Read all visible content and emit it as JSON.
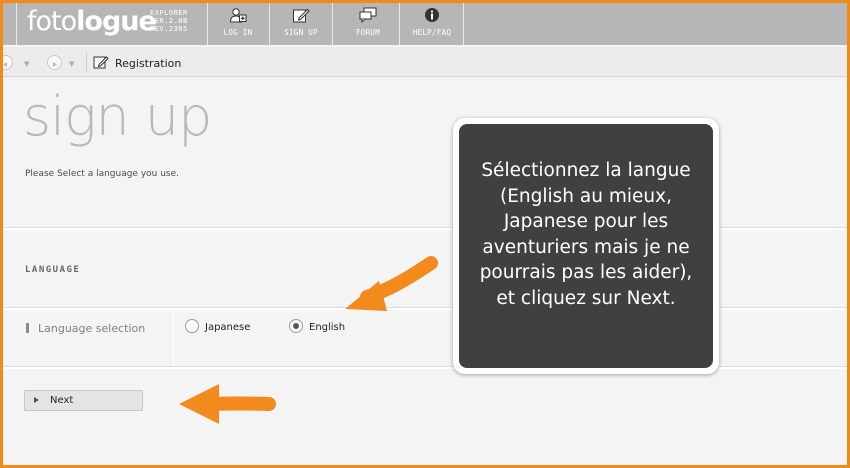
{
  "app": {
    "logo_text_light": "foto",
    "logo_text_bold": "logue",
    "logo_version_lines": [
      "EXPLORER",
      "VER.2.0B",
      "REV.2305"
    ]
  },
  "nav": {
    "items": [
      {
        "label": "LOG IN",
        "icon": "user-add-icon"
      },
      {
        "label": "SIGN UP",
        "icon": "edit-icon"
      },
      {
        "label": "FORUM",
        "icon": "chat-bubble-icon"
      },
      {
        "label": "HELP/FAQ",
        "icon": "info-icon"
      }
    ]
  },
  "toolbar": {
    "back_icon": "back-icon",
    "forward_icon": "forward-icon",
    "registration_icon": "edit-icon",
    "registration_label": "Registration"
  },
  "page": {
    "title": "sign up",
    "subtitle": "Please Select a language you use."
  },
  "section": {
    "title": "LANGUAGE",
    "row_label": "Language selection",
    "options": [
      {
        "label": "Japanese",
        "selected": false
      },
      {
        "label": "English",
        "selected": true
      }
    ]
  },
  "actions": {
    "next_label": "Next"
  },
  "annotation": {
    "text": "Sélectionnez la langue\n(English au mieux,\nJapanese pour les\naventuriers mais je ne\npourrais pas les aider),\net cliquez sur Next."
  },
  "colors": {
    "frame_border": "#ef8a1b",
    "arrow": "#f28a1e",
    "topbar": "#b6b6b6",
    "callout_bg": "#404040"
  }
}
